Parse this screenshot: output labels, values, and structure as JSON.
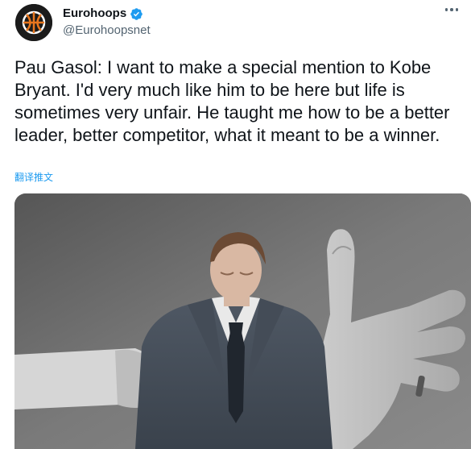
{
  "author": {
    "display_name": "Eurohoops",
    "handle": "@Eurohoopsnet",
    "verified": true,
    "avatar_icon": "basketball-logo-icon"
  },
  "tweet": {
    "text": "Pau Gasol: I want to make a special mention to Kobe Bryant. I'd very much like him to be here but life is sometimes very unfair. He taught me how to be a better leader, better competitor, what it meant to be a winner.",
    "translate_label": "翻译推文"
  },
  "colors": {
    "text_primary": "#0f1419",
    "text_secondary": "#536471",
    "accent_blue": "#1d9bf0",
    "avatar_orange": "#e8761e"
  }
}
